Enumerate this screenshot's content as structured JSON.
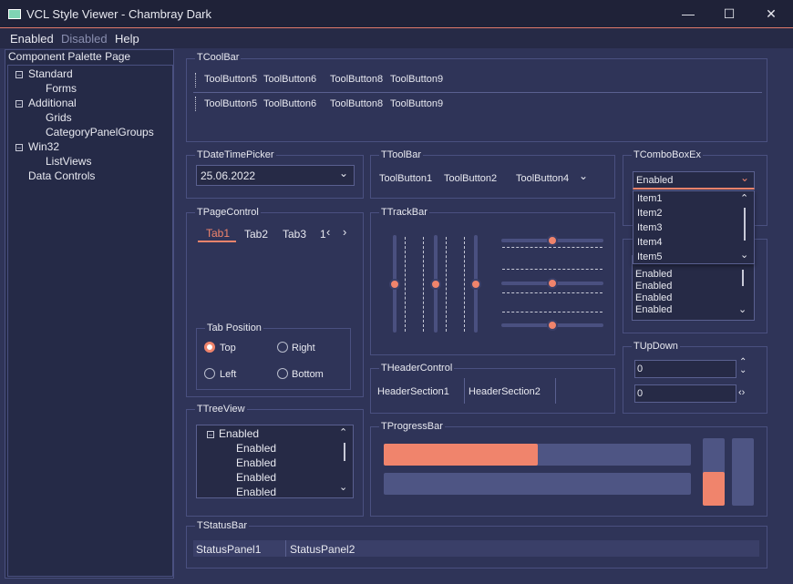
{
  "window": {
    "title": "VCL Style Viewer - Chambray Dark",
    "minimize": "—",
    "maximize": "☐",
    "close": "✕"
  },
  "menubar": {
    "items": [
      "Enabled",
      "Disabled",
      "Help"
    ]
  },
  "sidebar": {
    "header": "Component Palette Page",
    "tree": [
      {
        "label": "Standard",
        "children": [
          "Forms"
        ]
      },
      {
        "label": "Additional",
        "children": [
          "Grids",
          "CategoryPanelGroups"
        ]
      },
      {
        "label": "Win32",
        "children": [
          "ListViews"
        ]
      },
      {
        "label": "Data Controls",
        "children": []
      }
    ]
  },
  "coolbar": {
    "title": "TCoolBar",
    "band1": [
      "ToolButton5",
      "ToolButton6",
      "ToolButton8",
      "ToolButton9"
    ],
    "band2": [
      "ToolButton5",
      "ToolButton6",
      "ToolButton8",
      "ToolButton9"
    ]
  },
  "datetimepicker": {
    "title": "TDateTimePicker",
    "value": "25.06.2022"
  },
  "toolbar": {
    "title": "TToolBar",
    "buttons": [
      "ToolButton1",
      "ToolButton2",
      "ToolButton4"
    ]
  },
  "comboboxex": {
    "title": "TComboBoxEx",
    "value": "Enabled",
    "items": [
      "Item1",
      "Item2",
      "Item3",
      "Item4",
      "Item5"
    ]
  },
  "listbox": {
    "items": [
      "Enabled",
      "Enabled",
      "Enabled",
      "Enabled",
      "Enabled"
    ]
  },
  "pagecontrol": {
    "title": "TPageControl",
    "tabs": [
      "Tab1",
      "Tab2",
      "Tab3",
      "1"
    ],
    "active": "Tab1",
    "radiogroup": {
      "title": "Tab Position",
      "options": [
        "Top",
        "Right",
        "Left",
        "Bottom"
      ],
      "selected": "Top"
    }
  },
  "trackbar": {
    "title": "TTrackBar",
    "vertical_position": 0.5,
    "horizontal_top": 0.5,
    "horizontal_mid": 0.5,
    "horizontal_bottom": 0.5
  },
  "headercontrol": {
    "title": "THeaderControl",
    "sections": [
      "HeaderSection1",
      "HeaderSection2"
    ]
  },
  "updown": {
    "title": "TUpDown",
    "value1": "0",
    "value2": "0"
  },
  "treeview": {
    "title": "TTreeView",
    "root": "Enabled",
    "children": [
      "Enabled",
      "Enabled",
      "Enabled",
      "Enabled"
    ]
  },
  "progressbar": {
    "title": "TProgressBar",
    "horizontal1": 0.5,
    "horizontal2": 0.0,
    "vertical1": 0.5,
    "vertical2": 0.0
  },
  "statusbar": {
    "title": "TStatusBar",
    "panels": [
      "StatusPanel1",
      "StatusPanel2"
    ]
  },
  "colors": {
    "accent": "#f0846c",
    "background": "#2f3458",
    "panel": "#252a47",
    "border": "#4a5080"
  }
}
